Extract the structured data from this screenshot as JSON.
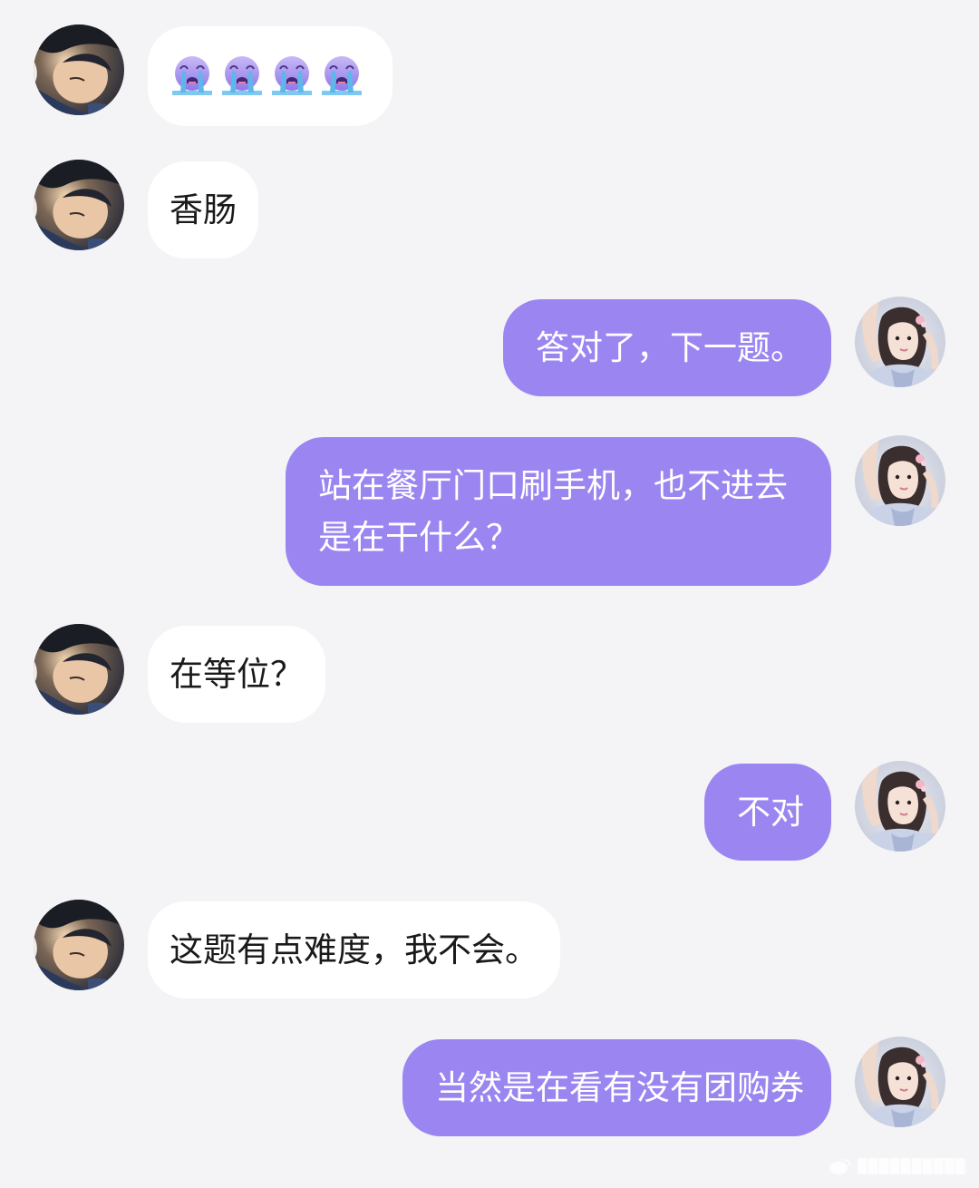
{
  "messages": [
    {
      "side": "in",
      "kind": "emoji",
      "emoji": [
        "crying-face",
        "crying-face",
        "crying-face",
        "crying-face"
      ]
    },
    {
      "side": "in",
      "text": "香肠"
    },
    {
      "side": "out",
      "text": "答对了，下一题。"
    },
    {
      "side": "out",
      "text": "站在餐厅门口刷手机，也不进去是在干什么？"
    },
    {
      "side": "in",
      "text": "在等位？"
    },
    {
      "side": "out",
      "text": "不对"
    },
    {
      "side": "in",
      "text": "这题有点难度，我不会。"
    },
    {
      "side": "out",
      "text": "当然是在看有没有团购券"
    }
  ],
  "colors": {
    "background": "#f4f4f6",
    "incoming_bubble": "#ffffff",
    "outgoing_bubble": "#9b86f1",
    "incoming_text": "#1a1a1a",
    "outgoing_text": "#ffffff"
  },
  "icons": {
    "incoming_avatar": "male-user-avatar",
    "outgoing_avatar": "female-user-avatar",
    "emoji": "crying-face"
  }
}
